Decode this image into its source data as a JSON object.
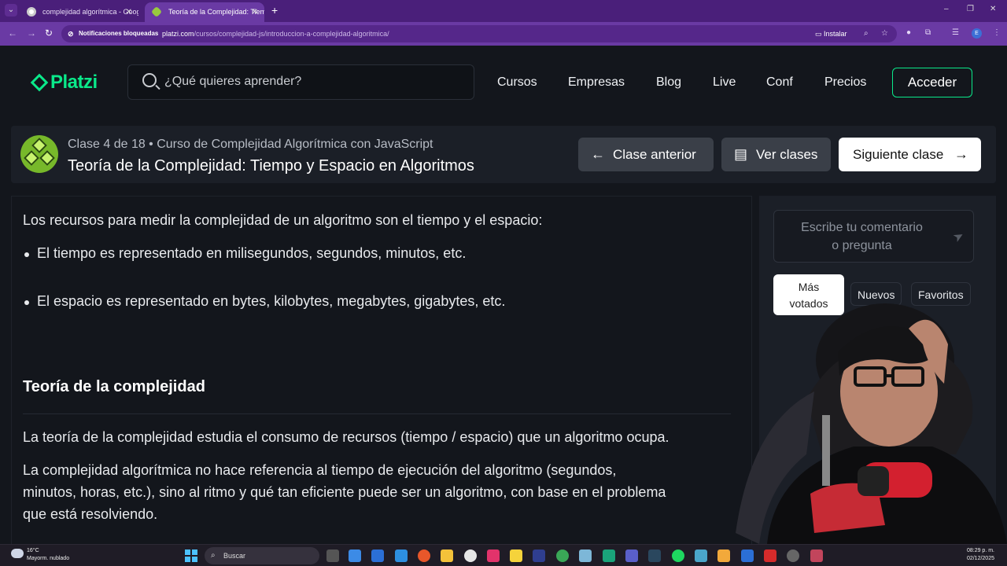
{
  "browser": {
    "tabs": [
      {
        "title": "complejidad algorítmica - Goog",
        "active": false
      },
      {
        "title": "Teoría de la Complejidad: Tiem",
        "active": true
      }
    ],
    "new_tab": "+",
    "window_controls": [
      "–",
      "❐",
      "✕"
    ],
    "notifications_blocked": "Notificaciones bloqueadas",
    "url_host": "platzi.com",
    "url_path": "/cursos/complejidad-js/introduccion-a-complejidad-algoritmica/",
    "install_label": "Instalar",
    "profile_initial": "E"
  },
  "header": {
    "logo": "Platzi",
    "search_placeholder": "¿Qué quieres aprender?",
    "nav": [
      "Cursos",
      "Empresas",
      "Blog",
      "Live",
      "Conf",
      "Precios"
    ],
    "login": "Acceder"
  },
  "class_bar": {
    "meta": "Clase 4 de 18 • Curso de Complejidad Algorítmica con JavaScript",
    "title": "Teoría de la Complejidad: Tiempo y Espacio en Algoritmos",
    "prev": "Clase anterior",
    "list": "Ver clases",
    "next": "Siguiente clase"
  },
  "content": {
    "intro": "Los recursos para medir la complejidad de un algoritmo son el tiempo y el espacio:",
    "bullets": [
      {
        "term": "El tiempo",
        "rest": " es representado en milisegundos, segundos, minutos, etc."
      },
      {
        "term": "El espacio",
        "rest": " es representado en bytes, kilobytes, megabytes, gigabytes, etc."
      }
    ],
    "heading": "Teoría de la complejidad",
    "p1_a": "La teoría de la complejidad estudia el ",
    "p1_b": "consumo de recursos",
    "p1_c": " (tiempo / espacio) que un algoritmo ocupa.",
    "p2_line1": "La complejidad algorítmica no hace referencia al tiempo de ejecución del algoritmo (segundos,",
    "p2_line2": "minutos, horas, etc.), sino al ritmo y qué tan eficiente puede ser un algoritmo, con base en el problema",
    "p2_line3": "que está resolviendo."
  },
  "sidebar": {
    "comment_line1": "Escribe tu comentario",
    "comment_line2": "o pregunta",
    "filters": [
      "Más",
      "votados",
      "Nuevos",
      "Favoritos"
    ]
  },
  "taskbar": {
    "temp": "16°C",
    "weather": "Mayorm. nublado",
    "search": "Buscar",
    "time": "08:29 p. m.",
    "date": "02/12/2025"
  },
  "colors": {
    "brand": "#0ae98a",
    "browser": "#6a3aa4",
    "badge": "#77b82a"
  }
}
